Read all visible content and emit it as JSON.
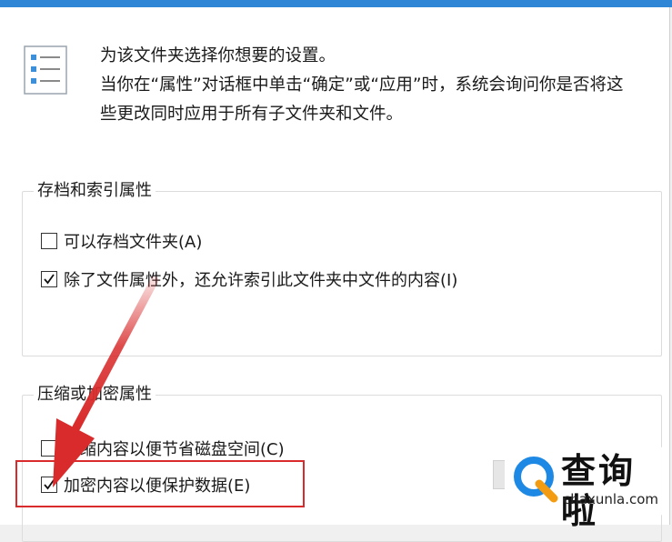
{
  "intro": {
    "line1": "为该文件夹选择你想要的设置。",
    "line2": "当你在“属性”对话框中单击“确定”或“应用”时，系统会询问你是否将这",
    "line3": "些更改同时应用于所有子文件夹和文件。"
  },
  "archive_group": {
    "title": "存档和索引属性",
    "items": [
      {
        "label": "可以存档文件夹(A)",
        "checked": false
      },
      {
        "label": "除了文件属性外，还允许索引此文件夹中文件的内容(I)",
        "checked": true
      }
    ]
  },
  "compress_group": {
    "title": "压缩或加密属性",
    "items": [
      {
        "label": "压缩内容以便节省磁盘空间(C)",
        "checked": false
      },
      {
        "label": "加密内容以便保护数据(E)",
        "checked": true
      }
    ]
  },
  "watermark": {
    "brand": "查询啦",
    "domain": "chaxunla.com"
  },
  "colors": {
    "title_bar": "#2f86d6",
    "annotation_red": "#d92b2b",
    "watermark_blue": "#1e88e5",
    "watermark_orange": "#f39c12"
  }
}
